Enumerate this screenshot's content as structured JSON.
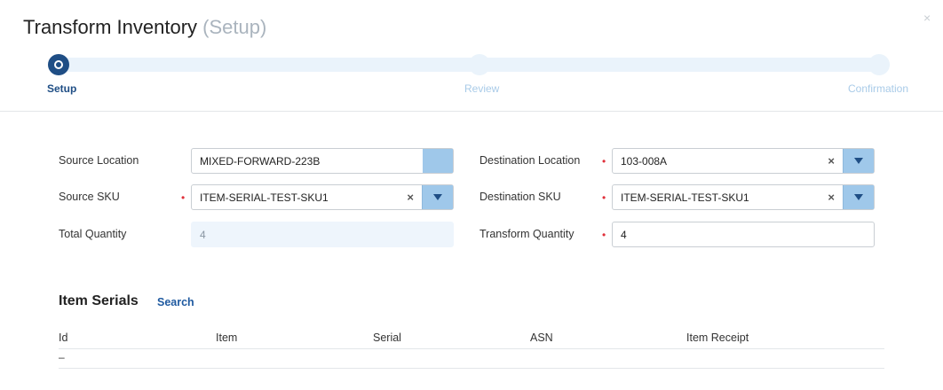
{
  "dialog": {
    "title": "Transform Inventory",
    "title_state": "(Setup)",
    "close_glyph": "×"
  },
  "steps": [
    {
      "label": "Setup",
      "active": true
    },
    {
      "label": "Review",
      "active": false
    },
    {
      "label": "Confirmation",
      "active": false
    }
  ],
  "form": {
    "source_location": {
      "label": "Source Location",
      "value": "MIXED-FORWARD-223B"
    },
    "source_sku": {
      "label": "Source SKU",
      "value": "ITEM-SERIAL-TEST-SKU1",
      "clear": "×"
    },
    "total_quantity": {
      "label": "Total Quantity",
      "value": "4"
    },
    "destination_location": {
      "label": "Destination Location",
      "value": "103-008A",
      "clear": "×"
    },
    "destination_sku": {
      "label": "Destination SKU",
      "value": "ITEM-SERIAL-TEST-SKU1",
      "clear": "×"
    },
    "transform_quantity": {
      "label": "Transform Quantity",
      "value": "4"
    },
    "required_marker": "•"
  },
  "item_serials": {
    "title": "Item Serials",
    "search_link": "Search",
    "columns": [
      "Id",
      "Item",
      "Serial",
      "ASN",
      "Item Receipt"
    ],
    "rows": [
      [
        "–",
        "",
        "",
        "",
        ""
      ]
    ]
  },
  "colors": {
    "accent": "#1f4e85",
    "step_inactive": "#a9cbe8",
    "required": "#e0303a",
    "dropdown_button": "#9fc8ea"
  }
}
